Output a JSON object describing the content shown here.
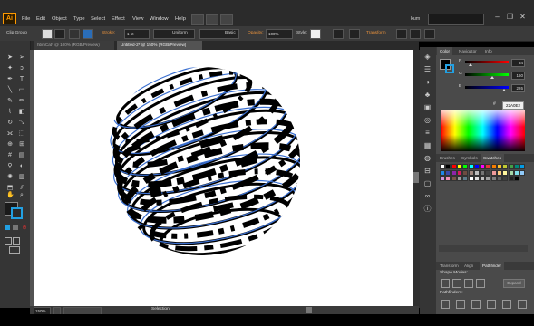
{
  "app": {
    "logo": "Ai",
    "username": "kum"
  },
  "menu": [
    "File",
    "Edit",
    "Object",
    "Type",
    "Select",
    "Effect",
    "View",
    "Window",
    "Help"
  ],
  "control_bar": {
    "selection_type": "Clip Group",
    "stroke_label": "Stroke:",
    "stroke_weight": "1 pt",
    "uniform_label": "Uniform",
    "basic_label": "Basic",
    "opacity_label": "Opacity:",
    "opacity_value": "100%",
    "style_label": "Style:",
    "transform_label": "Transform"
  },
  "tabs": [
    {
      "label": "hbmCat* @ 100% (RGB/Preview)",
      "active": false
    },
    {
      "label": "Untitled-2* @ 150% (RGB/Preview)",
      "active": true
    }
  ],
  "status": {
    "zoom": "150%",
    "mode": "Selection"
  },
  "color_panel": {
    "tabs": [
      "Color",
      "Navigator",
      "Info"
    ],
    "channels": [
      {
        "label": "R",
        "value": "34",
        "fraction": 0.13,
        "gradient": [
          "#000000",
          "#ff0000"
        ]
      },
      {
        "label": "G",
        "value": "160",
        "fraction": 0.63,
        "gradient": [
          "#000000",
          "#00ff00"
        ]
      },
      {
        "label": "B",
        "value": "226",
        "fraction": 0.89,
        "gradient": [
          "#000000",
          "#0000ff"
        ]
      }
    ],
    "hex_prefix": "#",
    "hex": "22A0E2",
    "current_color": "#22a0e2"
  },
  "swatches_panel": {
    "tabs": [
      "Brushes",
      "Symbols",
      "Swatches"
    ],
    "colors": [
      "#ffffff",
      "#000000",
      "#ff0000",
      "#ffff00",
      "#00ff00",
      "#00ffff",
      "#0000ff",
      "#ff00ff",
      "#e53935",
      "#f57c00",
      "#fbc02d",
      "#c0ca33",
      "#43a047",
      "#00897b",
      "#039be5",
      "#1e88e5",
      "#3949ab",
      "#8e24aa",
      "#d81b60",
      "#6d4c41",
      "#a1887f",
      "#bdbdbd",
      "#757575",
      "#424242",
      "#ef9a9a",
      "#ffcc80",
      "#fff59d",
      "#a5d6a7",
      "#80deea",
      "#90caf9",
      "#ce93d8",
      "#f48fb1",
      "#795548",
      "#9e9e9e",
      "#607d8b",
      "#ffffff",
      "#e0e0e0",
      "#c0c0c0",
      "#a0a0a0",
      "#808080",
      "#606060",
      "#404040",
      "#202020",
      "#000000"
    ]
  },
  "lower_panel": {
    "tabs": [
      "Transform",
      "Align",
      "Pathfinder"
    ],
    "shape_modes_label": "Shape Modes:",
    "pathfinders_label": "Pathfinders:",
    "expand_label": "Expand"
  }
}
